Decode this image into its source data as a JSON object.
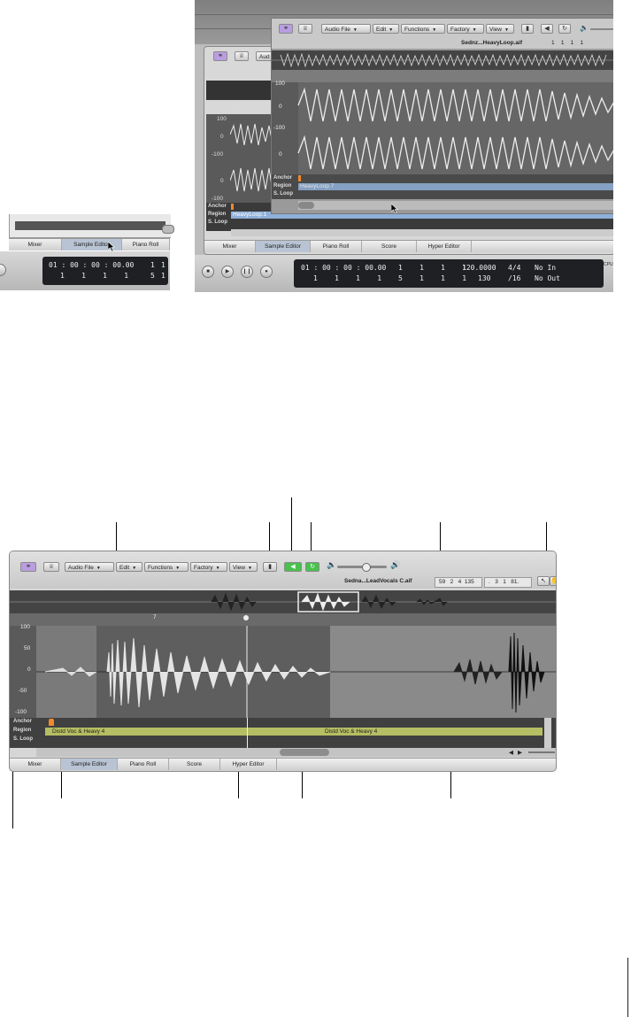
{
  "fig_a": {
    "tabs": [
      "Mixer",
      "Sample Editor",
      "Piano Roll"
    ],
    "lcd": {
      "time": "01 : 00 : 00 : 00.00",
      "bars": "1    1    1    1",
      "col_a_top": "1",
      "col_a_bot": "5",
      "col_b_top": "1",
      "col_b_bot": "1"
    }
  },
  "fig_b": {
    "menus": [
      "Audio File",
      "Edit",
      "Functions",
      "Factory",
      "View"
    ],
    "menu_partial": "Aud",
    "file_name": "Sednz...HeavyLoop.aif",
    "pos_values": "1    1    1    1",
    "ruler_mark": "1",
    "scale": {
      "top": "100",
      "mid": "0",
      "bot": "-100",
      "top2": "-100",
      "mid2": "0",
      "bot2": "-100",
      "back_top": "100",
      "back_mid": "0",
      "back_bot": "-100"
    },
    "lane_labels": {
      "anchor": "Anchor",
      "region": "Region",
      "sloop": "S. Loop"
    },
    "region_name": "HeavyLoop.1",
    "region_name_back": "HeavyLoop.7",
    "tabs": [
      "Mixer",
      "Sample Editor",
      "Piano Roll",
      "Score",
      "Hyper Editor"
    ],
    "lcd": {
      "time": "01 : 00 : 00 : 00.00",
      "bars": "1    1    1    1",
      "pos_top": "1    1    1    1",
      "pos_bot": "5    1    1    1",
      "tempo": "120.0000",
      "div": "130",
      "sig_top": "4/4",
      "sig_bot": "/16",
      "in": "No In",
      "out": "No Out",
      "cpu": "CPU"
    }
  },
  "fig_c": {
    "menus": [
      "Audio File",
      "Edit",
      "Functions",
      "Factory",
      "View"
    ],
    "file_name": "Sedna...LeadVocals C.aif",
    "pos_values": "59   2   4  135",
    "len_values": ".   3   1   81.",
    "ruler_mark": "7",
    "scale": [
      "100",
      "50",
      "0",
      "-50",
      "-100"
    ],
    "lane_labels": {
      "anchor": "Anchor",
      "region": "Region",
      "sloop": "S. Loop"
    },
    "region_name_left": "Distd Voc & Heavy 4",
    "region_name_mid": "Distd Voc & Heavy 4",
    "tabs": [
      "Mixer",
      "Sample Editor",
      "Piano Roll",
      "Score",
      "Hyper Editor"
    ]
  },
  "colors": {
    "accent_purple": "#b99de0",
    "green_button": "#49c14c",
    "region_green": "#b5be62",
    "region_blue": "#8fb0d9"
  }
}
